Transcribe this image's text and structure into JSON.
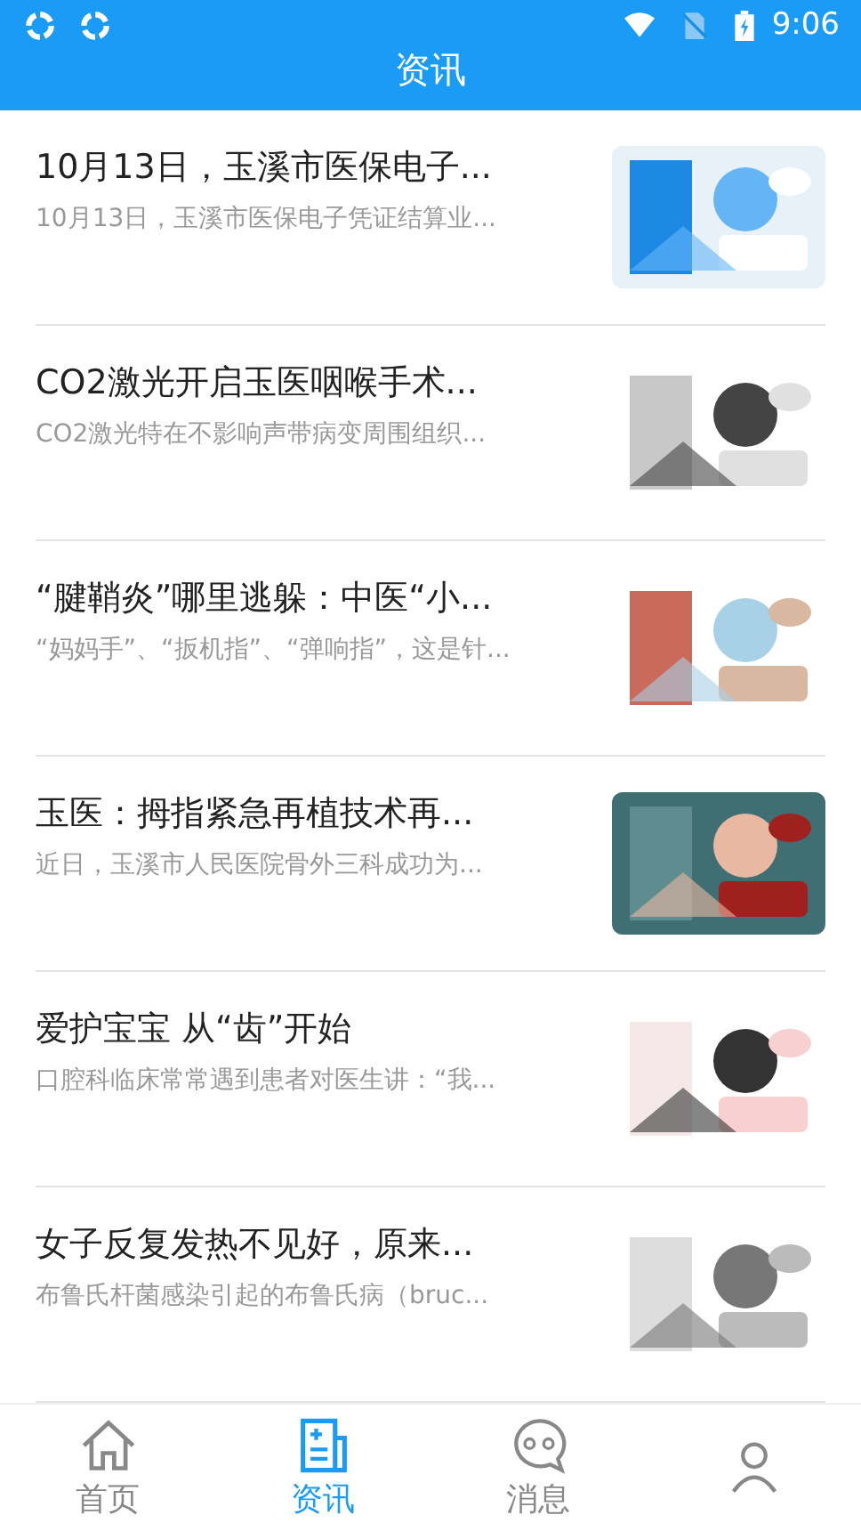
{
  "status_bar": {
    "time": "9:06"
  },
  "header": {
    "title": "资讯"
  },
  "articles": [
    {
      "title": "10月13日，玉溪市医保电子...",
      "summary": "10月13日，玉溪市医保电子凭证结算业...",
      "kind": "picture"
    },
    {
      "title": "CO2激光开启玉医咽喉手术...",
      "summary": "CO2激光特在不影响声带病变周围组织...",
      "kind": "picture"
    },
    {
      "title": "“腱鞘炎”哪里逃躲：中医“小...",
      "summary": "“妈妈手”、“扳机指”、“弹响指”，这是针...",
      "kind": "picture"
    },
    {
      "title": "玉医：拇指紧急再植技术再...",
      "summary": "近日，玉溪市人民医院骨外三科成功为...",
      "kind": "picture"
    },
    {
      "title": "爱护宝宝 从“齿”开始",
      "summary": "口腔科临床常常遇到患者对医生讲：“我...",
      "kind": "picture"
    },
    {
      "title": "女子反复发热不见好，原来...",
      "summary": "布鲁氏杆菌感染引起的布鲁氏病（bruc...",
      "kind": "picture"
    }
  ],
  "tabs": [
    {
      "label": "首页",
      "kind": "home",
      "selected": false
    },
    {
      "label": "资讯",
      "kind": "news",
      "selected": true
    },
    {
      "label": "消息",
      "kind": "chat",
      "selected": false
    },
    {
      "kind": "person",
      "selected": false
    }
  ]
}
